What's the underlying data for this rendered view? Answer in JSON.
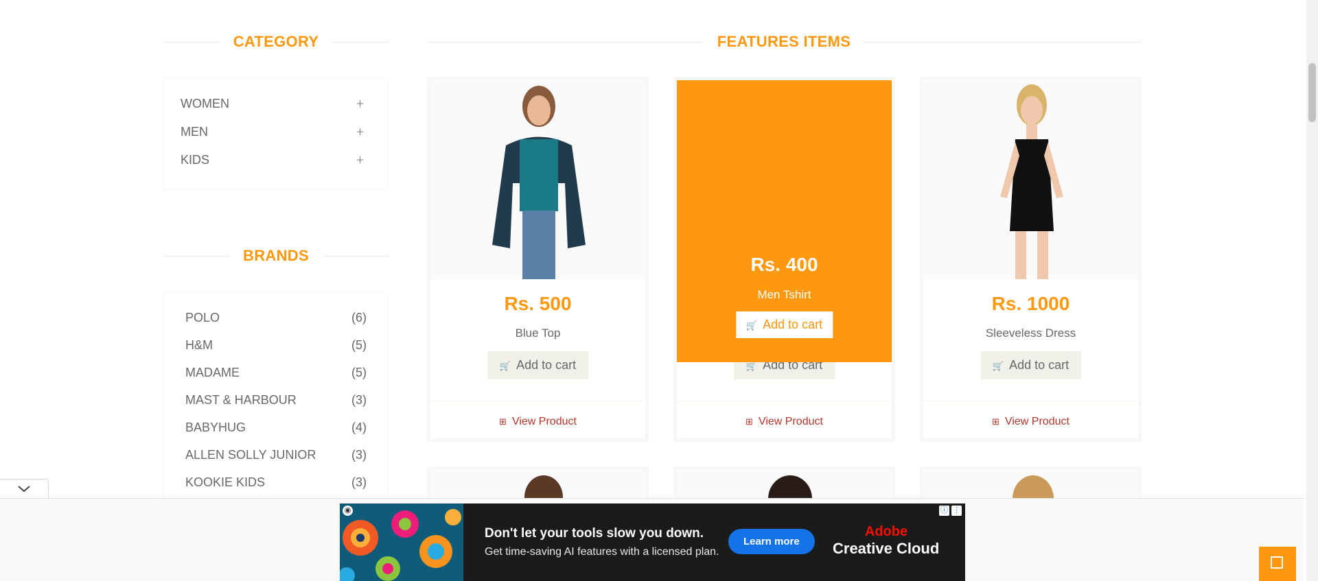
{
  "sidebar": {
    "category_title": "CATEGORY",
    "categories": [
      {
        "label": "WOMEN",
        "icon": "plus-icon"
      },
      {
        "label": "MEN",
        "icon": "plus-icon"
      },
      {
        "label": "KIDS",
        "icon": "plus-icon"
      }
    ],
    "brands_title": "BRANDS",
    "brands": [
      {
        "name": "POLO",
        "count": "(6)"
      },
      {
        "name": "H&M",
        "count": "(5)"
      },
      {
        "name": "MADAME",
        "count": "(5)"
      },
      {
        "name": "MAST & HARBOUR",
        "count": "(3)"
      },
      {
        "name": "BABYHUG",
        "count": "(4)"
      },
      {
        "name": "ALLEN SOLLY JUNIOR",
        "count": "(3)"
      },
      {
        "name": "KOOKIE KIDS",
        "count": "(3)"
      }
    ]
  },
  "features": {
    "title": "FEATURES ITEMS",
    "products": [
      {
        "price": "Rs. 500",
        "name": "Blue Top",
        "add_label": "Add to cart",
        "view_label": "View Product"
      },
      {
        "price": "Rs. 400",
        "name": "Men Tshirt",
        "add_label": "Add to cart",
        "view_label": "View Product",
        "hovered": true
      },
      {
        "price": "Rs. 1000",
        "name": "Sleeveless Dress",
        "add_label": "Add to cart",
        "view_label": "View Product"
      }
    ]
  },
  "ad": {
    "headline": "Don't let your tools slow you down.",
    "subtext": "Get time-saving AI features with a licensed plan.",
    "cta": "Learn more",
    "brand_line1": "Adobe",
    "brand_line2": "Creative Cloud"
  },
  "colors": {
    "accent": "#fe980f",
    "link": "#b3352c",
    "ad_button": "#1473e6"
  }
}
